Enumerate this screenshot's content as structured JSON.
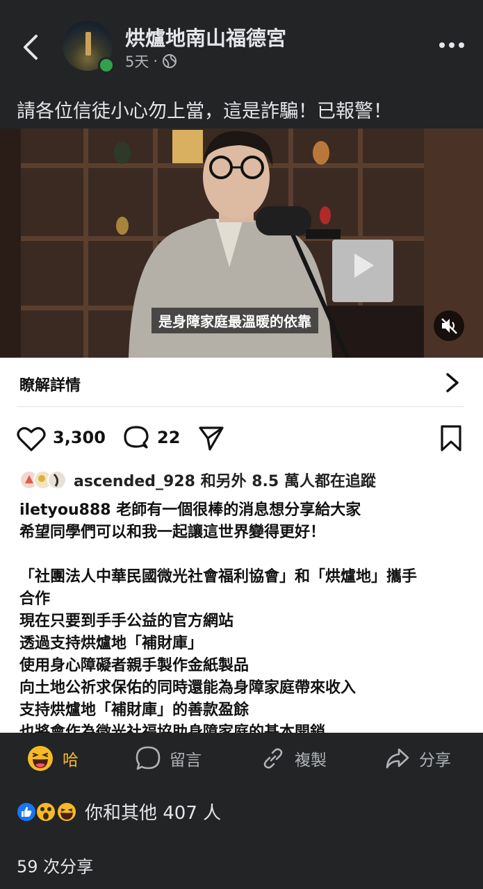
{
  "header": {
    "page_name": "烘爐地南山福德宮",
    "time": "5天",
    "separator": "·",
    "privacy_icon": "globe-icon"
  },
  "post": {
    "text": "請各位信徒小心勿上當，這是詐騙！已報警！"
  },
  "screenshot": {
    "video_subtitle": "是身障家庭最溫暖的依靠",
    "learn_more": "瞭解詳情",
    "likes": "3,300",
    "comments": "22",
    "followers_text": "ascended_928 和另外 8.5 萬人都在追蹤",
    "caption": {
      "username": "iletyou888",
      "lines": [
        "老師有一個很棒的消息想分享給大家",
        "希望同學們可以和我一起讓這世界變得更好！",
        "",
        "「社團法人中華民國微光社會福利協會」和「烘爐地」攜手",
        "合作",
        "現在只要到手手公益的官方網站",
        "透過支持烘爐地「補財庫」",
        "使用身心障礙者親手製作金紙製品",
        "向土地公祈求保佑的同時還能為身障家庭帶來收入",
        "支持烘爐地「補財庫」的善款盈餘",
        "也將會作為微光社福協助身障家庭的基本開銷"
      ]
    }
  },
  "actions": {
    "haha": "哈",
    "comment": "留言",
    "copy": "複製",
    "share": "分享"
  },
  "reactions": {
    "count_text": "你和其他 407 人"
  },
  "shares": {
    "text": "59 次分享"
  },
  "colors": {
    "background": "#222425",
    "haha_active": "#f7b928",
    "like_blue": "#1877f2",
    "online_green": "#31a24c"
  }
}
